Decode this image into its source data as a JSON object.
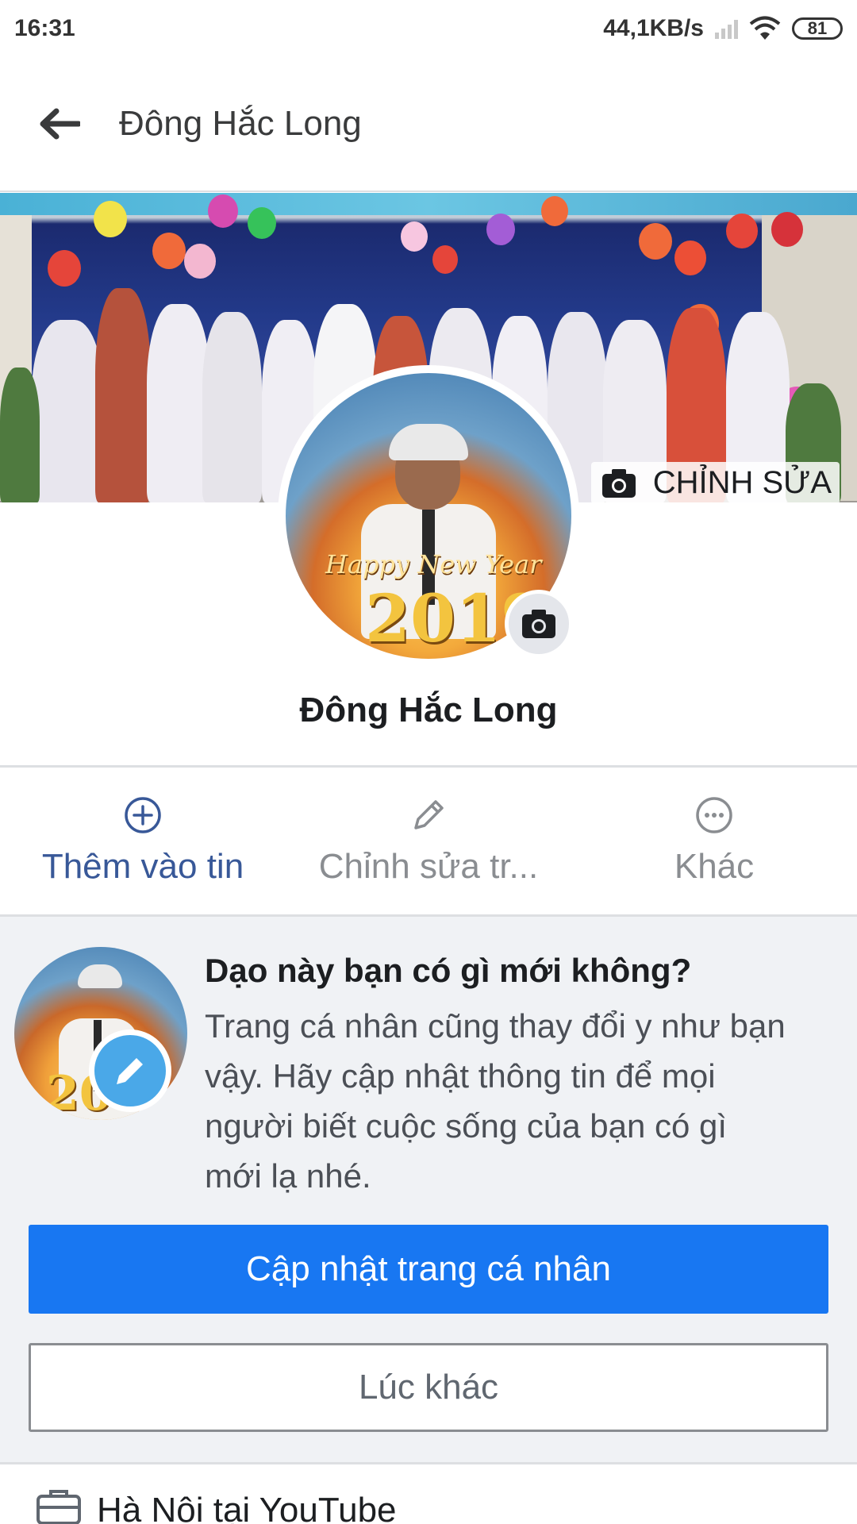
{
  "status_bar": {
    "time": "16:31",
    "network_speed": "44,1KB/s",
    "battery_level": "81",
    "icons": [
      "signal-icon",
      "wifi-icon",
      "battery-icon"
    ]
  },
  "header": {
    "title": "Đông Hắc Long",
    "back_icon": "back-arrow-icon"
  },
  "cover": {
    "edit_label": "CHỈNH SỬA",
    "edit_icon": "camera-icon"
  },
  "profile": {
    "name": "Đông Hắc Long",
    "avatar_camera_icon": "camera-icon"
  },
  "actions": [
    {
      "label": "Thêm vào tin",
      "icon": "plus-circle-icon"
    },
    {
      "label": "Chỉnh sửa tr...",
      "icon": "pencil-icon"
    },
    {
      "label": "Khác",
      "icon": "more-icon"
    }
  ],
  "prompt_card": {
    "title": "Dạo này bạn có gì mới không?",
    "body": "Trang cá nhân cũng thay đổi y như bạn vậy. Hãy cập nhật thông tin để mọi người biết cuộc sống của bạn có gì mới lạ nhé.",
    "update_button": "Cập nhật trang cá nhân",
    "later_button": "Lúc khác"
  },
  "info": {
    "work_text": "Hà Nội tại YouTube",
    "work_icon": "briefcase-icon"
  },
  "colors": {
    "primary": "#1877f2",
    "action_active": "#385898",
    "text_secondary": "#8a8d91",
    "card_background": "#f0f2f5"
  }
}
